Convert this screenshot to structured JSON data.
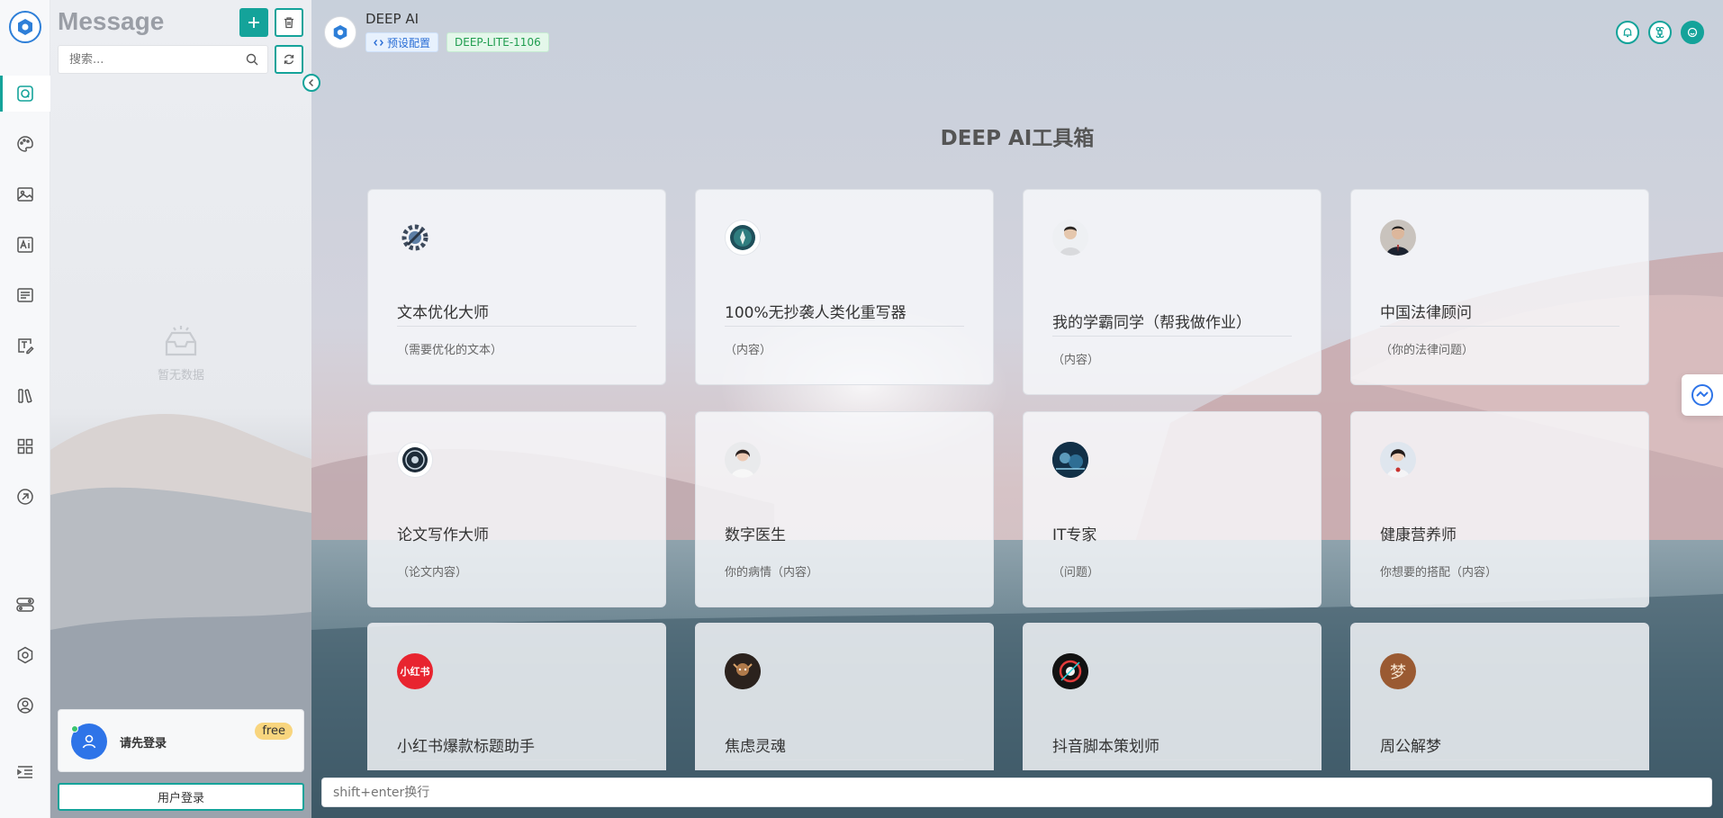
{
  "panel": {
    "title": "Message",
    "search_placeholder": "搜索...",
    "empty_text": "暂无数据",
    "login_text": "请先登录",
    "login_badge": "free",
    "login_button": "用户登录"
  },
  "header": {
    "title": "DEEP AI",
    "preset_label": "预设配置",
    "model_label": "DEEP-LITE-1106"
  },
  "main": {
    "title": "DEEP AI工具箱",
    "cards": [
      {
        "title": "文本优化大师",
        "desc": "（需要优化的文本）",
        "avatar": "gear-logo-icon"
      },
      {
        "title": "100%无抄袭人类化重写器",
        "desc": "（内容）",
        "avatar": "emblem-icon"
      },
      {
        "title": "我的学霸同学（帮我做作业）",
        "desc": "（内容）",
        "avatar": "student-avatar"
      },
      {
        "title": "中国法律顾问",
        "desc": "（你的法律问题）",
        "avatar": "lawyer-avatar"
      },
      {
        "title": "论文写作大师",
        "desc": "（论文内容）",
        "avatar": "badge-icon"
      },
      {
        "title": "数字医生",
        "desc": "你的病情（内容）",
        "avatar": "doctor-avatar"
      },
      {
        "title": "IT专家",
        "desc": "（问题）",
        "avatar": "tech-avatar"
      },
      {
        "title": "健康营养师",
        "desc": "你想要的搭配（内容）",
        "avatar": "nutritionist-avatar"
      },
      {
        "title": "小红书爆款标题助手",
        "desc": "",
        "avatar": "xiaohongshu-logo",
        "avatar_text": "小红书"
      },
      {
        "title": "焦虑灵魂",
        "desc": "",
        "avatar": "soul-avatar"
      },
      {
        "title": "抖音脚本策划师",
        "desc": "",
        "avatar": "douyin-avatar"
      },
      {
        "title": "周公解梦",
        "desc": "",
        "avatar": "dream-logo",
        "avatar_text": "梦"
      }
    ]
  },
  "input": {
    "placeholder": "shift+enter换行"
  },
  "colors": {
    "accent": "#14a39a",
    "brand_blue": "#2e74e8",
    "badge_yellow": "#f8d57e"
  }
}
